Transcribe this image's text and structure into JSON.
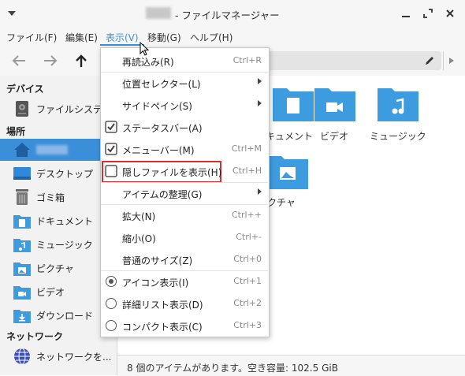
{
  "window": {
    "title_user": "user",
    "title": "- ファイルマネージャー"
  },
  "menubar": [
    "ファイル(F)",
    "編集(E)",
    "表示(V)",
    "移動(G)",
    "ヘルプ(H)"
  ],
  "sidebar": {
    "devices_header": "デバイス",
    "devices": [
      {
        "label": "ファイルシステ...",
        "icon": "hard-drive-icon"
      }
    ],
    "places_header": "場所",
    "places": [
      {
        "label": "user",
        "icon": "home-icon"
      },
      {
        "label": "デスクトップ",
        "icon": "desktop-icon"
      },
      {
        "label": "ゴミ箱",
        "icon": "trash-icon"
      },
      {
        "label": "ドキュメント",
        "icon": "documents-folder-icon"
      },
      {
        "label": "ミュージック",
        "icon": "music-folder-icon"
      },
      {
        "label": "ピクチャ",
        "icon": "pictures-folder-icon"
      },
      {
        "label": "ビデオ",
        "icon": "videos-folder-icon"
      },
      {
        "label": "ダウンロード",
        "icon": "downloads-folder-icon"
      }
    ],
    "network_header": "ネットワーク",
    "network": [
      {
        "label": "ネットワークを...",
        "icon": "network-globe-icon"
      }
    ]
  },
  "content": {
    "items": [
      {
        "label": "キュメント",
        "icon": "documents-folder-icon"
      },
      {
        "label": "ビデオ",
        "icon": "videos-folder-icon"
      },
      {
        "label": "ミュージック",
        "icon": "music-folder-icon"
      },
      {
        "label": "クチャ",
        "icon": "pictures-folder-icon"
      }
    ]
  },
  "status": "8 個のアイテムがあります。空き容量: 102.5 GiB",
  "view_menu": {
    "items": [
      {
        "label": "再読込み(R)",
        "shortcut": "Ctrl+R"
      },
      {
        "label": "位置セレクター(L)",
        "submenu": true
      },
      {
        "label": "サイドペイン(S)",
        "submenu": true
      },
      {
        "label": "ステータスバー(A)",
        "check": true
      },
      {
        "label": "メニューバー(M)",
        "shortcut": "Ctrl+M",
        "check": true
      },
      {
        "label": "隠しファイルを表示(H)",
        "shortcut": "Ctrl+H",
        "check": false,
        "highlighted": true
      },
      {
        "label": "アイテムの整理(G)",
        "submenu": true
      },
      {
        "label": "拡大(N)",
        "shortcut": "Ctrl++"
      },
      {
        "label": "縮小(O)",
        "shortcut": "Ctrl+-"
      },
      {
        "label": "普通のサイズ(Z)",
        "shortcut": "Ctrl+0"
      },
      {
        "label": "アイコン表示(I)",
        "shortcut": "Ctrl+1",
        "radio": true
      },
      {
        "label": "詳細リスト表示(D)",
        "shortcut": "Ctrl+2",
        "radio": false
      },
      {
        "label": "コンパクト表示(C)",
        "shortcut": "Ctrl+3",
        "radio": false
      }
    ]
  },
  "colors": {
    "accent": "#3b8fd9",
    "folder": "#3d9be0",
    "highlight_border": "#d62f2f"
  }
}
